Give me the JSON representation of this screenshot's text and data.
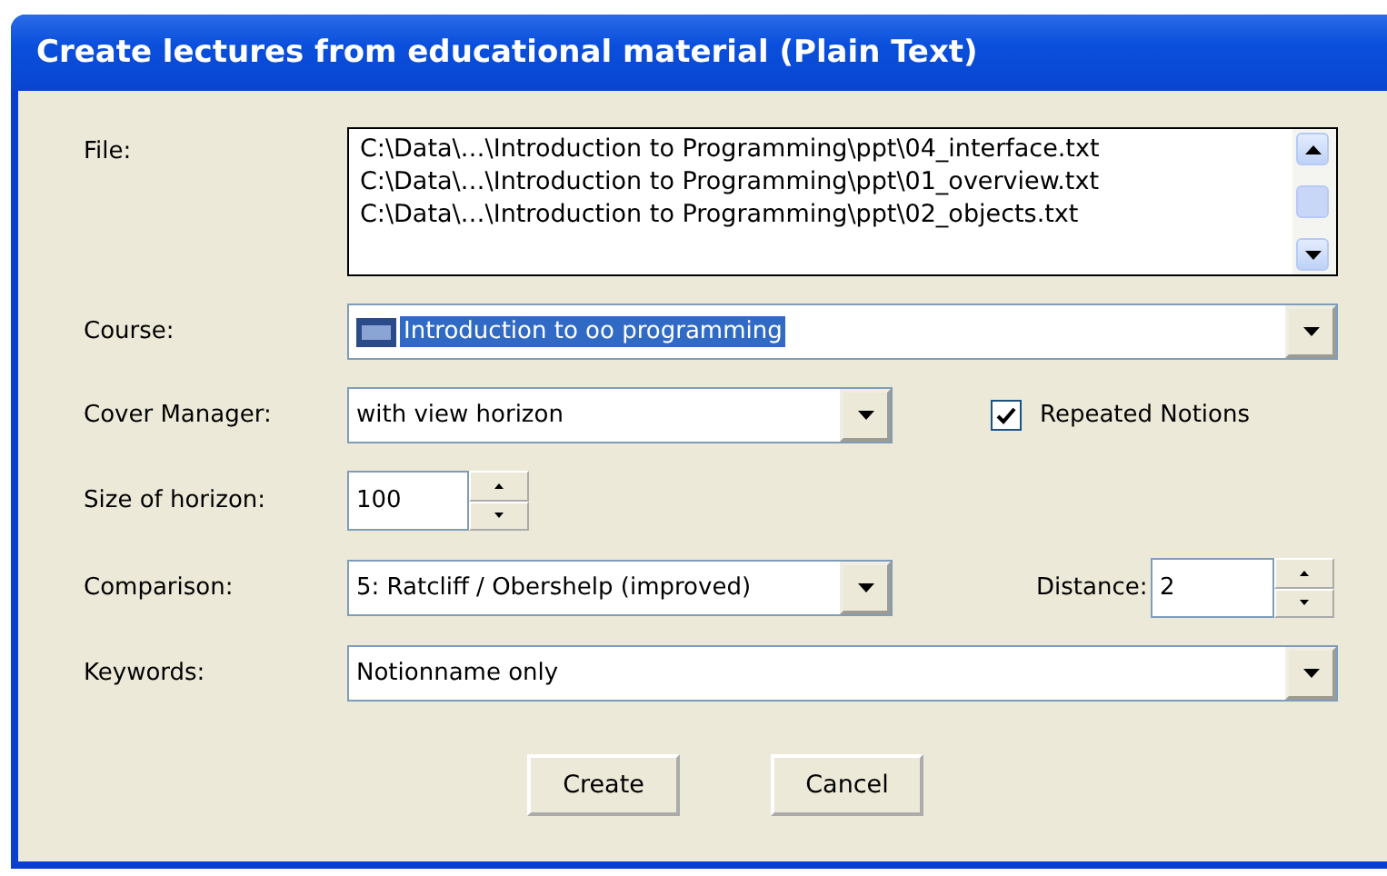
{
  "window": {
    "title": "Create lectures from educational material (Plain Text)"
  },
  "file": {
    "label": "File:",
    "items": [
      {
        "text": "C:\\Data\\…\\Introduction to Programming\\ppt\\04_interface.txt",
        "selected": false
      },
      {
        "text": "C:\\Data\\…\\Introduction to Programming\\ppt\\01_overview.txt",
        "selected": false
      },
      {
        "text": "C:\\Data\\…\\Introduction to Programming\\ppt\\02_objects.txt",
        "selected": false
      }
    ]
  },
  "course": {
    "label": "Course:",
    "value": "Introduction to oo programming",
    "selected": true
  },
  "cover_manager": {
    "label": "Cover Manager:",
    "value": "with view horizon"
  },
  "repeated_notions": {
    "label": "Repeated Notions",
    "checked": true
  },
  "size_of_horizon": {
    "label": "Size of horizon:",
    "value": "100"
  },
  "comparison": {
    "label": "Comparison:",
    "value": "5: Ratcliff / Obershelp (improved)"
  },
  "distance": {
    "label": "Distance:",
    "value": "2"
  },
  "keywords": {
    "label": "Keywords:",
    "value": "Notionname only"
  },
  "buttons": [
    "Create",
    "Cancel"
  ]
}
